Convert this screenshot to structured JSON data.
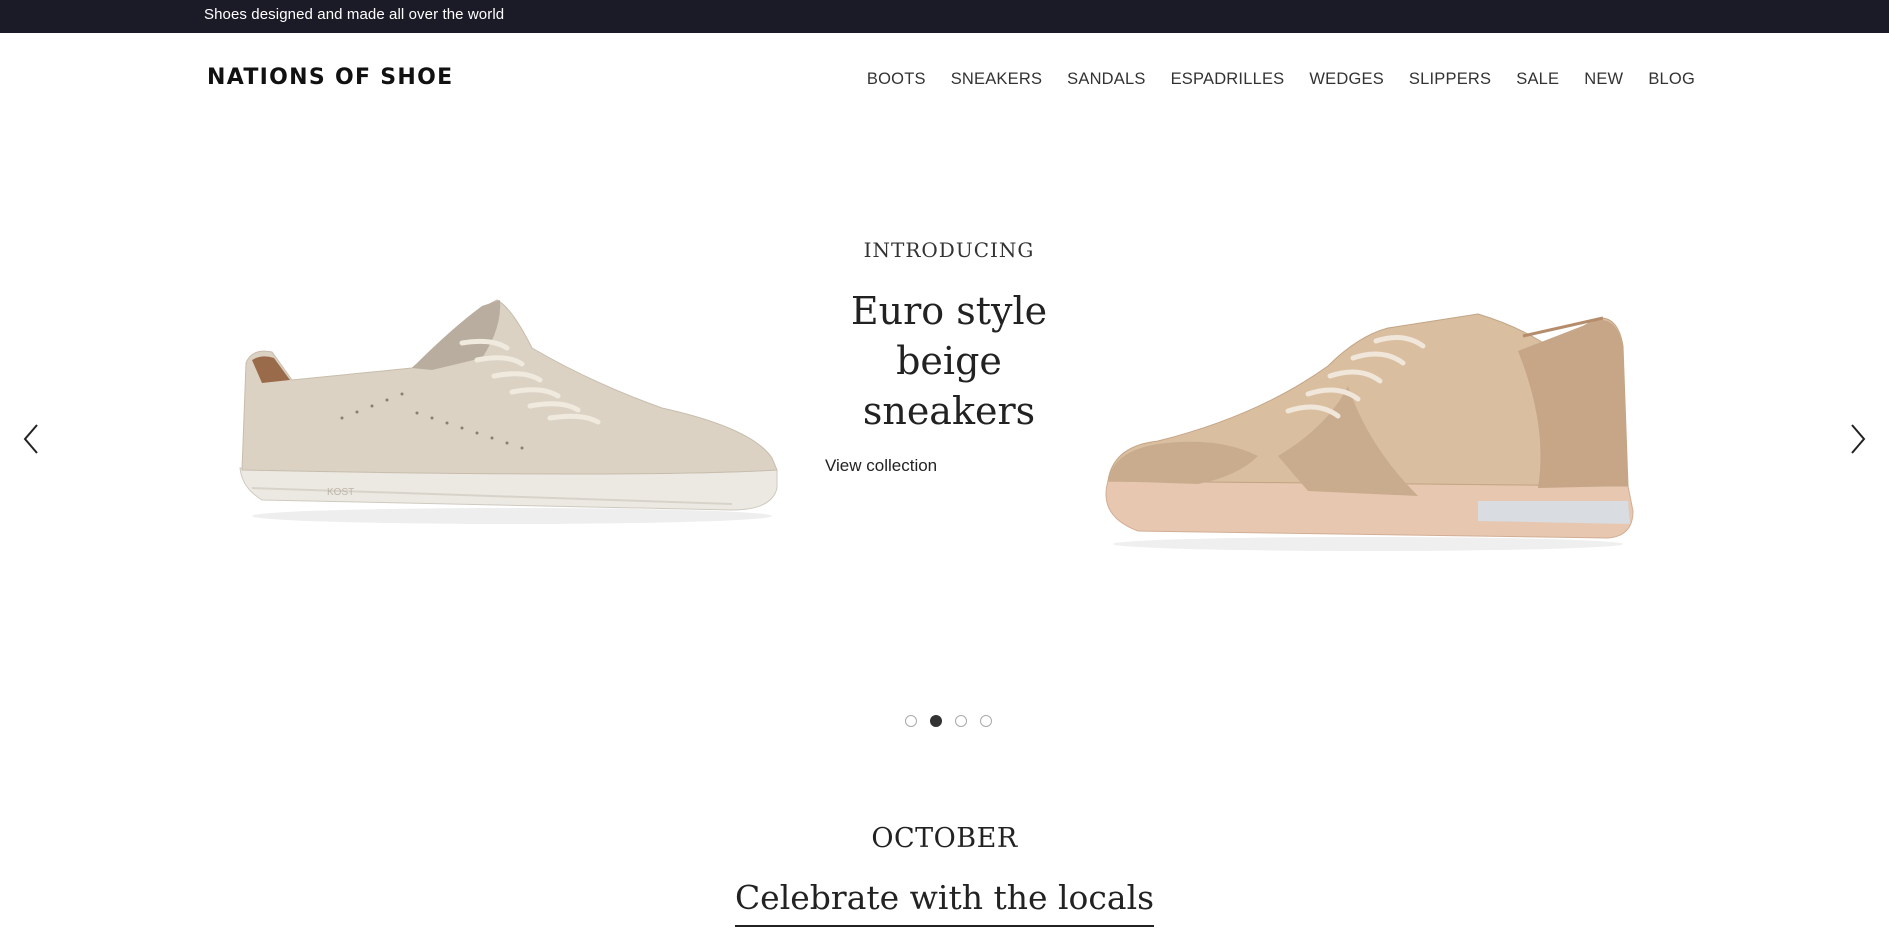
{
  "topbar": {
    "text": "Shoes designed and made all over the world"
  },
  "header": {
    "logo": "NATIONS OF SHOE",
    "nav": [
      "BOOTS",
      "SNEAKERS",
      "SANDALS",
      "ESPADRILLES",
      "WEDGES",
      "SLIPPERS",
      "SALE",
      "NEW",
      "BLOG"
    ]
  },
  "hero": {
    "kicker": "INTRODUCING",
    "headline_line1": "Euro style",
    "headline_line2": "beige sneakers",
    "cta": "View collection",
    "slides": {
      "count": 4,
      "active": 2
    },
    "left_shoe_brand": "KOST"
  },
  "section": {
    "kicker": "OCTOBER",
    "title": "Celebrate with the locals"
  },
  "colors": {
    "topbar_bg": "#1b1b27",
    "text": "#222222",
    "shoe_left": "#dbd2c4",
    "shoe_right": "#c9ac8e"
  }
}
